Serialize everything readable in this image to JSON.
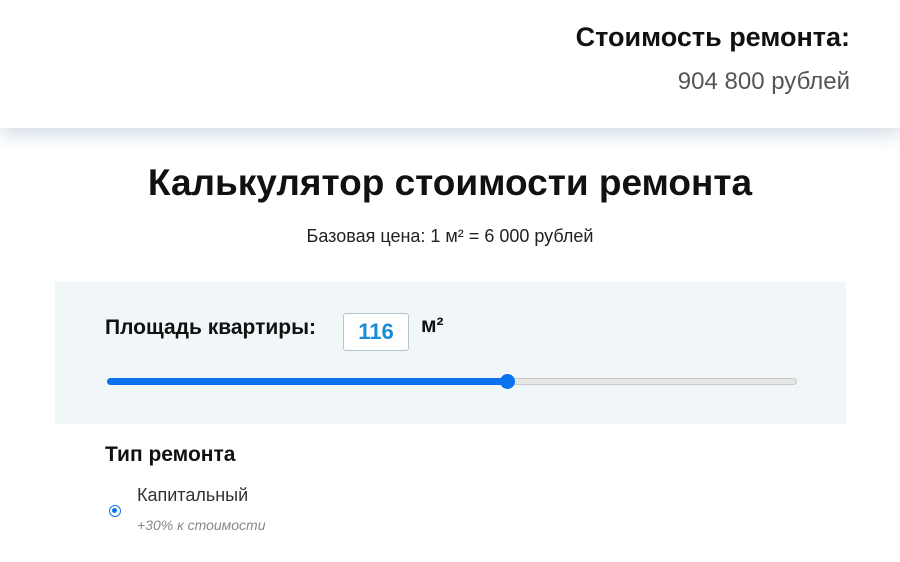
{
  "header": {
    "cost_title": "Стоимость ремонта:",
    "cost_value": "904 800 рублей"
  },
  "main": {
    "title": "Калькулятор стоимости ремонта",
    "base_price": "Базовая цена: 1 м² = 6 000 рублей"
  },
  "area": {
    "label": "Площадь квартиры:",
    "value": "116",
    "unit": "м²",
    "slider_fraction": 0.58
  },
  "repair_type": {
    "heading": "Тип ремонта",
    "options": [
      {
        "label": "Капитальный",
        "note": "+30% к стоимости",
        "selected": true
      }
    ]
  },
  "colors": {
    "accent": "#0a73f0",
    "value_blue": "#1a8cd8",
    "panel_bg": "#f1f6f9"
  }
}
